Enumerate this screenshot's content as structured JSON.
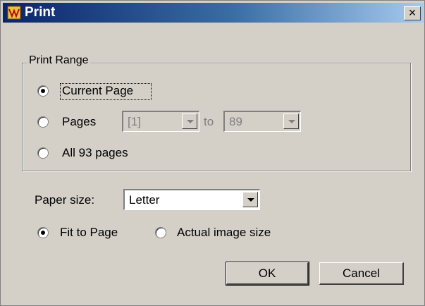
{
  "window": {
    "title": "Print",
    "close_label": "×"
  },
  "print_range": {
    "group_label": "Print Range",
    "current_page_label": "Current Page",
    "pages_label": "Pages",
    "pages_from_value": "[1]",
    "to_label": "to",
    "pages_to_value": "89",
    "all_pages_label": "All 93 pages",
    "selected": "current_page"
  },
  "paper": {
    "size_label": "Paper size:",
    "size_value": "Letter"
  },
  "scaling": {
    "fit_label": "Fit to Page",
    "actual_label": "Actual image size",
    "selected": "fit"
  },
  "buttons": {
    "ok_label": "OK",
    "cancel_label": "Cancel"
  },
  "colors": {
    "titlebar_start": "#0a246a",
    "titlebar_end": "#a6caf0",
    "face": "#d4d0c8"
  }
}
